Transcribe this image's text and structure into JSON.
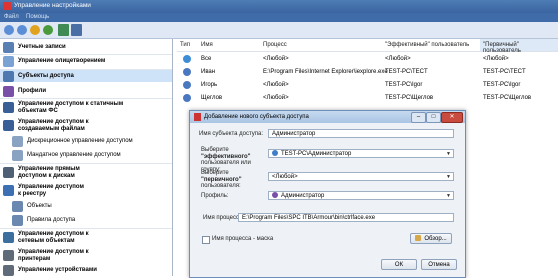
{
  "window": {
    "title": "Управление настройками"
  },
  "menu": {
    "file": "Файл",
    "help": "Помощь"
  },
  "sidebar": {
    "items": [
      {
        "label": "Учетные записи"
      },
      {
        "label": "Управление олицетворением"
      },
      {
        "label": "Субъекты доступа"
      },
      {
        "label": "Профили"
      },
      {
        "label": "Управление доступом к статичным объектам ФС"
      },
      {
        "label": "Управление доступом к создаваемым файлам"
      },
      {
        "label": "Дискреционное управление доступом"
      },
      {
        "label": "Мандатное управление доступом"
      },
      {
        "label": "Управление прямым доступом к дискам"
      },
      {
        "label": "Управление доступом к реестру"
      },
      {
        "label": "Объекты"
      },
      {
        "label": "Правила доступа"
      },
      {
        "label": "Управление доступом к сетевым объектам"
      },
      {
        "label": "Управление доступом к принтерам"
      },
      {
        "label": "Управление устройствами"
      }
    ]
  },
  "table": {
    "headers": {
      "type": "Тип",
      "name": "Имя",
      "process": "Процесс",
      "effective": "\"Эффективный\" пользователь",
      "primary": "\"Первичный\" пользователь"
    },
    "rows": [
      {
        "name": "Все",
        "process": "<Любой>",
        "effective": "<Любой>",
        "primary": "<Любой>"
      },
      {
        "name": "Иван",
        "process": "E:\\Program Files\\Internet Explorer\\iexplore.exe",
        "effective": "TEST-PC\\TECT",
        "primary": "TEST-PC\\TECT"
      },
      {
        "name": "Игорь",
        "process": "<Любой>",
        "effective": "TEST-PC\\Igor",
        "primary": "TEST-PC\\Igor"
      },
      {
        "name": "Щеглов",
        "process": "<Любой>",
        "effective": "TEST-PC\\Щеглов",
        "primary": "TEST-PC\\Щеглов"
      }
    ]
  },
  "dialog": {
    "title": "Добавление нового субъекта доступа",
    "subject_name_label": "Имя субъекта доступа:",
    "subject_name_value": "Администратор",
    "effective_label_pre": "Выберите ",
    "effective_label_bold": "\"эффективного\"",
    "effective_label_post": "пользователя или группу:",
    "effective_value": "TEST-PC\\Администратор",
    "primary_label_pre": "Выберите ",
    "primary_label_bold": "\"первичного\"",
    "primary_label_post": "пользователя:",
    "primary_value": "<Любой>",
    "profile_label": "Профиль:",
    "profile_value": "Администратор",
    "process_label": "Имя процесса:",
    "process_value": "E:\\Program Files\\SPC ITB\\Armour\\bin\\ctrlface.exe",
    "mask_label": "Имя процесса - маска",
    "browse_label": "Обзор...",
    "ok_label": "ОК",
    "cancel_label": "Отмена",
    "min_label": "–",
    "max_label": "□",
    "close_label": "✕"
  }
}
